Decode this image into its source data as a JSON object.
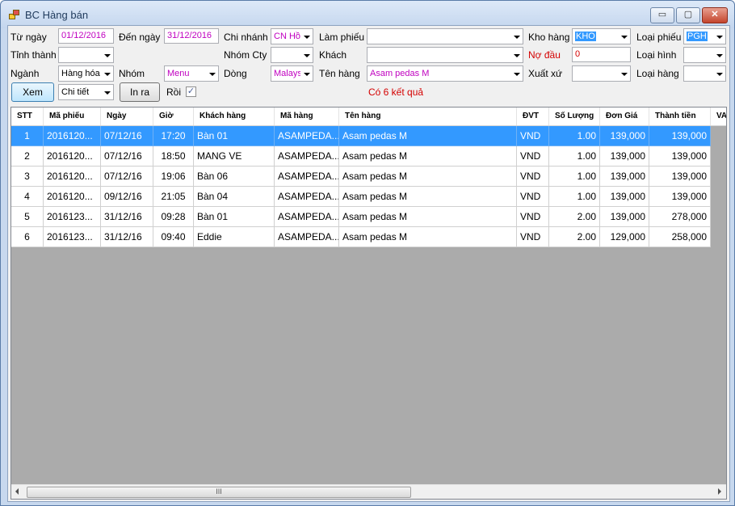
{
  "window": {
    "title": "BC Hàng bán",
    "min_label": "▭",
    "max_label": "▢",
    "close_label": "✕"
  },
  "filters": {
    "tu_ngay": {
      "label": "Từ ngày",
      "value": "01/12/2016"
    },
    "den_ngay": {
      "label": "Đến ngày",
      "value": "31/12/2016"
    },
    "chi_nhanh": {
      "label": "Chi nhánh",
      "value": "CN Hồ"
    },
    "lam_phieu": {
      "label": "Làm phiếu",
      "value": ""
    },
    "kho_hang": {
      "label": "Kho hàng",
      "value": "KHO"
    },
    "loai_phieu": {
      "label": "Loại phiếu",
      "value": "PGH"
    },
    "tinh_thanh": {
      "label": "Tỉnh thành",
      "value": ""
    },
    "nhom_cty": {
      "label": "Nhóm Cty",
      "value": ""
    },
    "khach": {
      "label": "Khách",
      "value": ""
    },
    "no_dau": {
      "label": "Nợ đầu",
      "value": "0"
    },
    "loai_hinh": {
      "label": "Loại hình",
      "value": ""
    },
    "nganh": {
      "label": "Ngành",
      "value": "Hàng hóa"
    },
    "nhom": {
      "label": "Nhóm",
      "value": "Menu"
    },
    "dong": {
      "label": "Dòng",
      "value": "Malays"
    },
    "ten_hang": {
      "label": "Tên hàng",
      "value": "Asam pedas M"
    },
    "xuat_xu": {
      "label": "Xuất xứ",
      "value": ""
    },
    "loai_hang": {
      "label": "Loại hàng",
      "value": ""
    },
    "che_do": {
      "value": "Chi tiết"
    },
    "roi": {
      "label": "Rồi",
      "checked": true
    }
  },
  "buttons": {
    "xem": "Xem",
    "in_ra": "In ra"
  },
  "result_text": "Có 6 kết quả",
  "table": {
    "columns": [
      "STT",
      "Mã phiếu",
      "Ngày",
      "Giờ",
      "Khách hàng",
      "Mã hàng",
      "Tên hàng",
      "ĐVT",
      "Số Lượng",
      "Đơn Giá",
      "Thành tiền",
      "VAT"
    ],
    "rows": [
      [
        "1",
        "2016120...",
        "07/12/16",
        "17:20",
        "Bàn 01",
        "ASAMPEDA...",
        "Asam pedas M",
        "VND",
        "1.00",
        "139,000",
        "139,000"
      ],
      [
        "2",
        "2016120...",
        "07/12/16",
        "18:50",
        "MANG VE",
        "ASAMPEDA...",
        "Asam pedas M",
        "VND",
        "1.00",
        "139,000",
        "139,000"
      ],
      [
        "3",
        "2016120...",
        "07/12/16",
        "19:06",
        "Bàn 06",
        "ASAMPEDA...",
        "Asam pedas M",
        "VND",
        "1.00",
        "139,000",
        "139,000"
      ],
      [
        "4",
        "2016120...",
        "09/12/16",
        "21:05",
        "Bàn 04",
        "ASAMPEDA...",
        "Asam pedas M",
        "VND",
        "1.00",
        "139,000",
        "139,000"
      ],
      [
        "5",
        "2016123...",
        "31/12/16",
        "09:28",
        "Bàn 01",
        "ASAMPEDA...",
        "Asam pedas M",
        "VND",
        "2.00",
        "139,000",
        "278,000"
      ],
      [
        "6",
        "2016123...",
        "31/12/16",
        "09:40",
        "Eddie",
        "ASAMPEDA...",
        "Asam pedas M",
        "VND",
        "2.00",
        "129,000",
        "258,000"
      ]
    ],
    "selected_row": 0
  },
  "scrollbar": {
    "thumb_label": "III"
  },
  "colors": {
    "selection": "#3399ff",
    "purple_value": "#c000c0",
    "red_text": "#d40000",
    "grid_bg": "#ababab"
  }
}
